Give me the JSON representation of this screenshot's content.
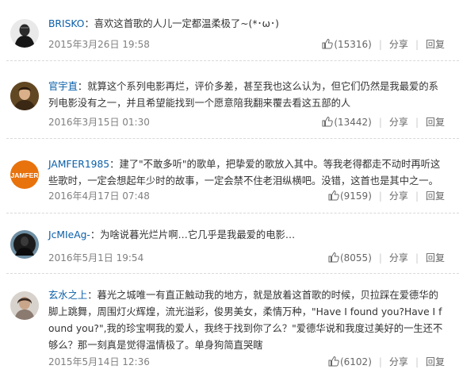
{
  "comments": [
    {
      "user": "BRISKO",
      "text": "喜欢这首歌的人儿一定都温柔极了~(*･ω･)",
      "time": "2015年3月26日 19:58",
      "likes": "(15316)",
      "share": "分享",
      "reply": "回复"
    },
    {
      "user": "官宇直",
      "text": "就算这个系列电影再烂，评价多差，甚至我也这么认为，但它们仍然是我最爱的系列电影没有之一，并且希望能找到一个愿意陪我翻来覆去看这五部的人",
      "time": "2016年3月15日 01:30",
      "likes": "(13442)",
      "share": "分享",
      "reply": "回复"
    },
    {
      "user": "JAMFER1985",
      "avatar_text": "JAMFER",
      "text": "建了\"不敢多听\"的歌单，把挚爱的歌放入其中。等我老得都走不动时再听这些歌时，一定会想起年少时的故事，一定会禁不住老泪纵横吧。没错，这首也是其中之一。",
      "time": "2016年4月17日 07:48",
      "likes": "(9159)",
      "share": "分享",
      "reply": "回复"
    },
    {
      "user": "JcMIeAg-",
      "text": "为啥说暮光烂片啊…它几乎是我最爱的电影…",
      "time": "2016年5月1日 19:54",
      "likes": "(8055)",
      "share": "分享",
      "reply": "回复"
    },
    {
      "user": "玄水之上",
      "text": "暮光之城唯一有直正触动我的地方，就是放着这首歌的时候，贝拉踩在爱德华的脚上跳舞，周围灯火辉煌，流光溢彩，俊男美女，柔情万种，\"Have I found you?Have I found you?\",我的珍宝啊我的爱人，我终于找到你了么？\"爱德华说和我度过美好的一生还不够么？那一刻真是觉得温情极了。单身狗简直哭瞎",
      "time": "2015年5月14日 12:36",
      "likes": "(6102)",
      "share": "分享",
      "reply": "回复"
    }
  ],
  "colors": {
    "username": "#0a5fa8",
    "body_text": "#333333",
    "meta_text": "#808080",
    "divider": "#d9d9d9",
    "jamfer_avatar": "#e8720c"
  },
  "icons": {
    "like": "thumbs-up-icon"
  }
}
